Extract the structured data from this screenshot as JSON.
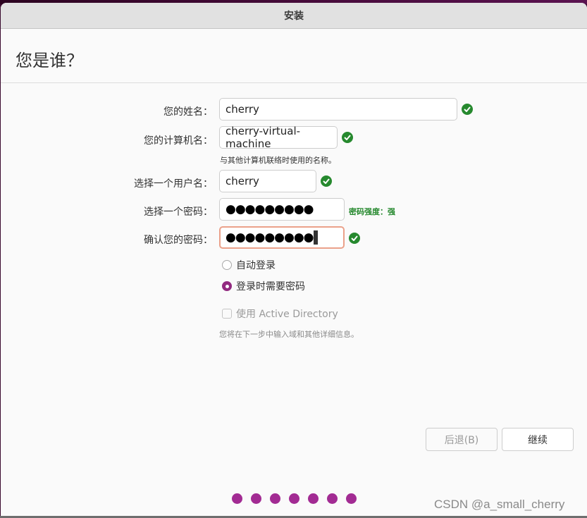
{
  "window": {
    "title": "安装"
  },
  "page": {
    "title": "您是谁？"
  },
  "form": {
    "name": {
      "label": "您的姓名：",
      "value": "cherry",
      "valid": true
    },
    "computer_name": {
      "label": "您的计算机名：",
      "value": "cherry-virtual-machine",
      "valid": true,
      "hint": "与其他计算机联络时使用的名称。"
    },
    "username": {
      "label": "选择一个用户名：",
      "value": "cherry",
      "valid": true
    },
    "password": {
      "label": "选择一个密码：",
      "masked_value": "●●●●●●●●●",
      "strength": "密码强度：强"
    },
    "confirm_password": {
      "label": "确认您的密码：",
      "masked_value": "●●●●●●●●●",
      "valid": true,
      "focused": true
    },
    "login_options": [
      {
        "label": "自动登录",
        "selected": false
      },
      {
        "label": "登录时需要密码",
        "selected": true
      }
    ],
    "active_directory": {
      "label": "使用 Active Directory",
      "checked": false,
      "enabled": false,
      "hint": "您将在下一步中输入域和其他详细信息。"
    }
  },
  "buttons": {
    "back": {
      "label": "后退(B)",
      "enabled": false
    },
    "continue": {
      "label": "继续",
      "enabled": true
    }
  },
  "progress": {
    "total_steps": 7,
    "accent_color": "#a22b93"
  },
  "colors": {
    "valid": "#26892e",
    "focus_border": "#eba18a",
    "radio_selected": "#922a80"
  },
  "watermark": "CSDN @a_small_cherry"
}
